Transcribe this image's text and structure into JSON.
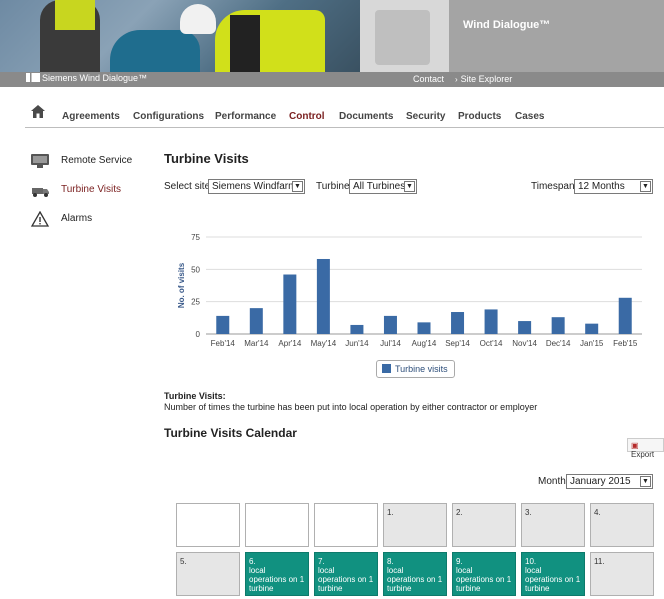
{
  "header": {
    "app_title": "Wind Dialogue™",
    "brand": "Siemens Wind Dialogue™",
    "contact": "Contact",
    "site_explorer": "Site Explorer"
  },
  "nav": {
    "items": [
      "Agreements",
      "Configurations",
      "Performance",
      "Control",
      "Documents",
      "Security",
      "Products",
      "Cases"
    ],
    "active": "Control"
  },
  "sidebar": {
    "items": [
      {
        "label": "Remote Service",
        "icon": "monitor-icon"
      },
      {
        "label": "Turbine Visits",
        "icon": "truck-icon",
        "active": true
      },
      {
        "label": "Alarms",
        "icon": "warning-icon"
      }
    ]
  },
  "page": {
    "title": "Turbine Visits"
  },
  "filters": {
    "site_label": "Select site",
    "site_value": "Siemens Windfarm",
    "turbine_label": "Turbine",
    "turbine_value": "All Turbines",
    "timespan_label": "Timespan",
    "timespan_value": "12 Months"
  },
  "chart_data": {
    "type": "bar",
    "categories": [
      "Feb'14",
      "Mar'14",
      "Apr'14",
      "May'14",
      "Jun'14",
      "Jul'14",
      "Aug'14",
      "Sep'14",
      "Oct'14",
      "Nov'14",
      "Dec'14",
      "Jan'15",
      "Feb'15"
    ],
    "series": [
      {
        "name": "Turbine visits",
        "values": [
          14,
          20,
          46,
          58,
          7,
          14,
          9,
          17,
          19,
          10,
          13,
          8,
          28
        ]
      }
    ],
    "ylabel": "No. of visits",
    "ylim": [
      0,
      75
    ],
    "yticks": [
      0,
      25,
      50,
      75
    ],
    "grid": true,
    "legend_position": "bottom",
    "bar_color": "#3a6aa5"
  },
  "description": {
    "title": "Turbine Visits:",
    "text": "Number of times the turbine has been put into local operation by either contractor or employer"
  },
  "calendar": {
    "title": "Turbine Visits Calendar",
    "export_label": "Export",
    "month_label": "Month",
    "month_value": "January 2015",
    "rows": [
      [
        {
          "type": "blank",
          "text": ""
        },
        {
          "type": "blank",
          "text": ""
        },
        {
          "type": "blank",
          "text": ""
        },
        {
          "type": "grey",
          "text": "1."
        },
        {
          "type": "grey",
          "text": "2."
        },
        {
          "type": "grey",
          "text": "3."
        },
        {
          "type": "grey",
          "text": "4."
        }
      ],
      [
        {
          "type": "grey",
          "text": "5."
        },
        {
          "type": "teal",
          "text": "6.\nlocal operations on 1 turbine"
        },
        {
          "type": "teal",
          "text": "7.\nlocal operations on 1 turbine"
        },
        {
          "type": "teal",
          "text": "8.\nlocal operations on 1 turbine"
        },
        {
          "type": "teal",
          "text": "9.\nlocal operations on 1 turbine"
        },
        {
          "type": "teal",
          "text": "10.\nlocal operations on 1 turbine"
        },
        {
          "type": "grey",
          "text": "11."
        }
      ]
    ]
  }
}
